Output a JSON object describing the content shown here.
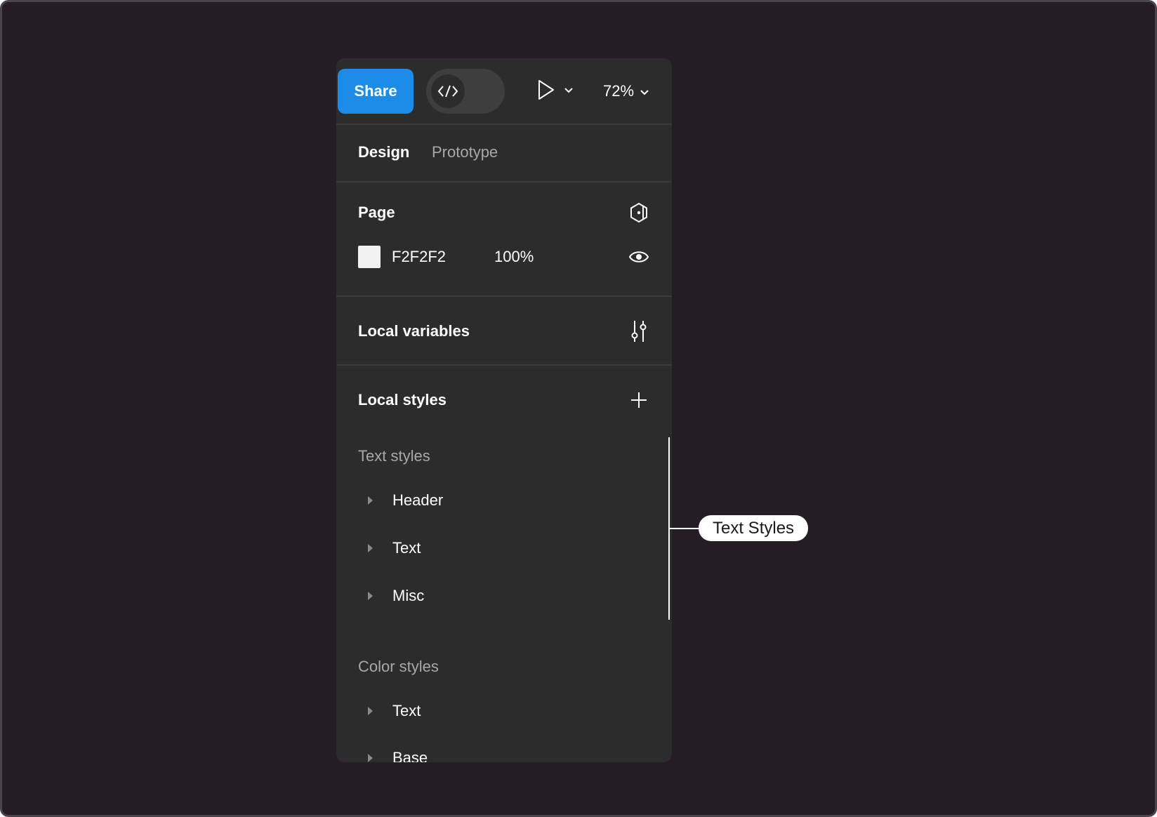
{
  "toolbar": {
    "share_label": "Share",
    "zoom_value": "72%"
  },
  "tabs": [
    {
      "label": "Design",
      "active": true
    },
    {
      "label": "Prototype",
      "active": false
    }
  ],
  "page": {
    "title": "Page",
    "color_hex": "F2F2F2",
    "opacity": "100%",
    "swatch_color": "#F2F2F2"
  },
  "local_variables": {
    "title": "Local variables"
  },
  "local_styles": {
    "title": "Local styles",
    "text_styles": {
      "heading": "Text styles",
      "items": [
        "Header",
        "Text",
        "Misc"
      ]
    },
    "color_styles": {
      "heading": "Color styles",
      "items": [
        "Text",
        "Base"
      ]
    }
  },
  "annotation": {
    "label": "Text Styles"
  },
  "colors": {
    "accent": "#1D8CE6",
    "panel_bg": "#2C2C2C",
    "canvas_bg": "#251C26"
  },
  "icons": [
    "code-icon",
    "play-icon",
    "chevron-down-icon",
    "library-icon",
    "eye-icon",
    "sliders-icon",
    "plus-icon",
    "caret-right-icon"
  ]
}
